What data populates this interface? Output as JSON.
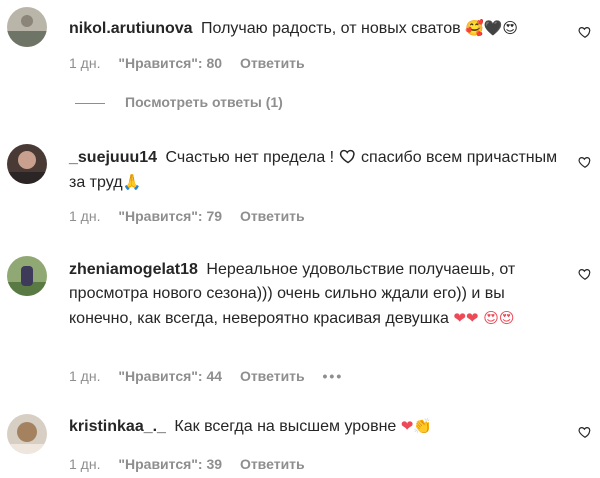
{
  "comments": [
    {
      "username": "nikol.arutiunova",
      "text": "Получаю радость, от новых сватов",
      "emoji": "🥰🖤😍",
      "time": "1 дн.",
      "likes": "\"Нравится\": 80",
      "reply": "Ответить"
    },
    {
      "username": "_suejuuu14",
      "text": "Счастью нет предела !",
      "text2": "спасибо всем причастным за труд",
      "emoji": "🙏",
      "time": "1 дн.",
      "likes": "\"Нравится\": 79",
      "reply": "Ответить"
    },
    {
      "username": "zheniamogelat18",
      "text": "Нереальное удовольствие получаешь, от просмотра нового сезона))) очень сильно ждали его)) и вы конечно, как всегда, невероятно красивая девушка",
      "emoji": "❤❤ 😍😍",
      "time": "1 дн.",
      "likes": "\"Нравится\": 44",
      "reply": "Ответить",
      "more": "•••"
    },
    {
      "username": "kristinkaa_._",
      "text": "Как всегда на высшем уровне",
      "emoji": "❤👏",
      "time": "1 дн.",
      "likes": "\"Нравится\": 39",
      "reply": "Ответить"
    }
  ],
  "view_replies": "Посмотреть ответы (1)",
  "colors": {
    "text": "#262626",
    "muted": "#8e8e8e",
    "heart_red": "#ed4956"
  }
}
